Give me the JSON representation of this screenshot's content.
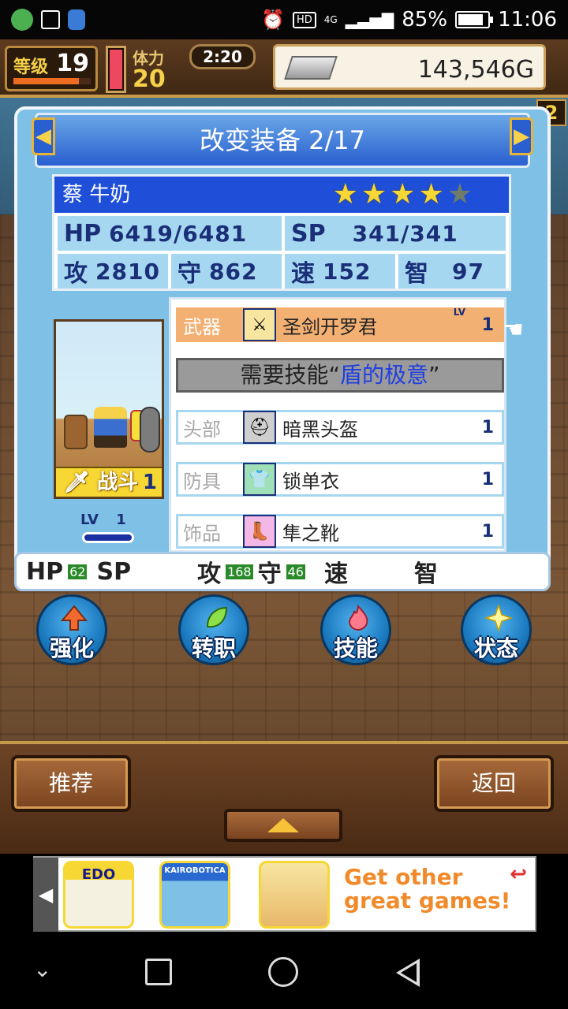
{
  "status_bar": {
    "hd": "HD",
    "network": "4G",
    "battery": "85%",
    "battery_level": 0.85,
    "time": "11:06"
  },
  "hud": {
    "level_label": "等级",
    "level": "19",
    "stamina_label": "体力",
    "stamina": "20",
    "clock": "2:20",
    "gold": "143,546G",
    "side_tab": "2"
  },
  "panel": {
    "title": "改变装备 2/17",
    "character": {
      "name": "蔡 牛奶",
      "stars_total": 5,
      "stars_on": 4,
      "hp_label": "HP",
      "hp": "6419/6481",
      "sp_label": "SP",
      "sp": "341/341",
      "atk_label": "攻",
      "atk": "2810",
      "def_label": "守",
      "def": "862",
      "spd_label": "速",
      "spd": "152",
      "int_label": "智",
      "int": "97"
    },
    "portrait": {
      "job_tag": "战斗",
      "job_level": "1",
      "lv_label": "LV",
      "lv": "1"
    },
    "lv_tag": "LV",
    "equipment": {
      "weapon": {
        "slot": "武器",
        "name": "圣剑开罗君",
        "level": "1"
      },
      "need_skill_prefix": "需要技能“",
      "need_skill_name": "盾的极意",
      "need_skill_suffix": "”",
      "head": {
        "slot": "头部",
        "name": "暗黑头盔",
        "level": "1"
      },
      "armor": {
        "slot": "防具",
        "name": "锁单衣",
        "level": "1"
      },
      "accessory": {
        "slot": "饰品",
        "name": "隼之靴",
        "level": "1"
      }
    },
    "stat_diff": {
      "hp_label": "HP",
      "hp": "62",
      "sp_label": "SP",
      "atk_label": "攻",
      "atk": "168",
      "def_label": "守",
      "def": "46",
      "spd_label": "速",
      "int_label": "智"
    }
  },
  "actions": {
    "enhance": "强化",
    "job_change": "转职",
    "skill": "技能",
    "status": "状态"
  },
  "bottom": {
    "recommend": "推荐",
    "back": "返回"
  },
  "ad": {
    "game1": "EDO",
    "game2": "KAIROBOTICA",
    "cta_line1": "Get other",
    "cta_line2": "great games!"
  },
  "colors": {
    "title_blue": "#2a5fd0",
    "selected_row": "#f2b072",
    "star": "#f7d733",
    "action_blue": "#1b7abf"
  }
}
